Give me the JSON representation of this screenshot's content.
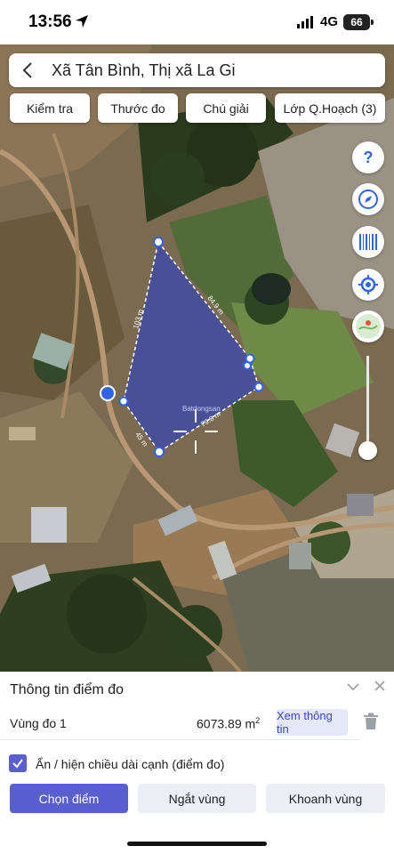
{
  "status_bar": {
    "time": "13:56",
    "network": "4G",
    "battery": "66",
    "icons": [
      "location-arrow-icon",
      "signal-icon",
      "battery-icon"
    ]
  },
  "header": {
    "back_icon": "chevron-left-icon",
    "title": "Xã Tân Bình, Thị xã La Gi"
  },
  "toolbar": {
    "chips": [
      "Kiểm tra",
      "Thước đo",
      "Chú giải",
      "Lớp Q.Hoạch (3)"
    ]
  },
  "map": {
    "edge_labels": [
      "103 m",
      "84.9 m",
      "79.8 m",
      "45 m"
    ],
    "watermark": "Batdongsan",
    "tools": [
      "help-icon",
      "compass-icon",
      "barcode-icon",
      "my-location-icon",
      "map-layer-icon"
    ],
    "colors": {
      "polygon_fill": "#3f4aa8",
      "vertex": "#2f64e8"
    }
  },
  "panel": {
    "title": "Thông tin điểm đo",
    "area_label": "Vùng đo 1",
    "area_value": "6073.89 m",
    "area_unit_sup": "2",
    "view_info_label": "Xem thông tin",
    "checkbox_label": "Ẩn / hiện chiều dài cạnh (điểm đo)",
    "checkbox_checked": true,
    "buttons": {
      "select_point": "Chọn điểm",
      "break_region": "Ngắt vùng",
      "enclose_region": "Khoanh vùng"
    },
    "accent": "#5a5fd0"
  }
}
